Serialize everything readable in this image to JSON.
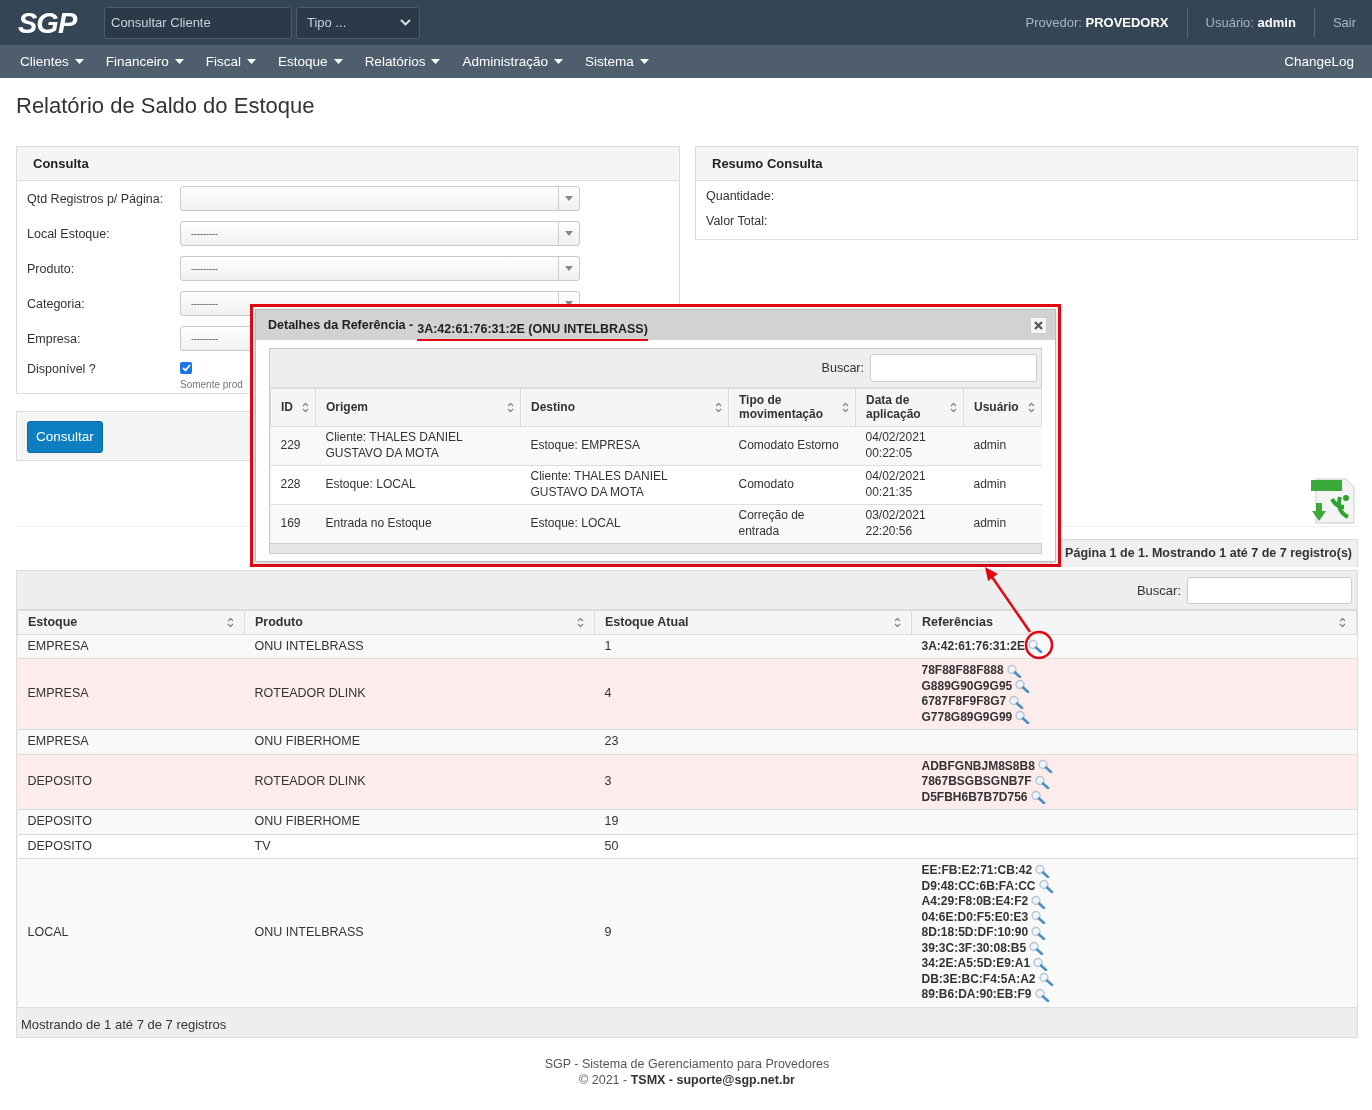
{
  "header": {
    "logo": "SGP",
    "search": {
      "placeholder": "Consultar Cliente"
    },
    "type_select": {
      "value": "Tipo ..."
    },
    "provider": "Provedor: **PROVEDORX**",
    "user": "Usuário: **admin**",
    "logout": "Sair"
  },
  "menu": {
    "items": [
      "Clientes",
      "Financeiro",
      "Fiscal",
      "Estoque",
      "Relatórios",
      "Administração",
      "Sistema"
    ],
    "changelog": "ChangeLog"
  },
  "page_title": "Relatório de Saldo do Estoque",
  "consulta": {
    "title": "Consulta",
    "fields": [
      {
        "label": "Qtd Registros p/ Página:",
        "kind": "select"
      },
      {
        "label": "Local Estoque:",
        "kind": "select",
        "value": "---------"
      },
      {
        "label": "Produto:",
        "kind": "select",
        "value": "---------"
      },
      {
        "label": "Categoria:",
        "kind": "select",
        "value": "---------"
      },
      {
        "label": "Empresa:",
        "kind": "select",
        "value": "---------"
      },
      {
        "label": "Disponível ?",
        "kind": "checkbox",
        "checked": true,
        "hint": "Somente prod"
      }
    ],
    "button": "Consultar"
  },
  "resumo": {
    "title": "Resumo Consulta",
    "fields": [
      "Quantidade:",
      "Valor Total:"
    ]
  },
  "results": {
    "pagination": "Página 1 de 1. Mostrando 1 até 7 de 7 registro(s)",
    "search_label": "Buscar:",
    "columns": [
      "Estoque",
      "Produto",
      "Estoque Atual",
      "Referências"
    ],
    "rows": [
      {
        "estoque": "EMPRESA",
        "produto": "ONU INTELBRASS",
        "estoque_atual": "1",
        "highlighted": false,
        "referencias": [
          "3A:42:61:76:31:2E"
        ]
      },
      {
        "estoque": "EMPRESA",
        "produto": "ROTEADOR DLINK",
        "estoque_atual": "4",
        "highlighted": true,
        "referencias": [
          "78F88F88F888",
          "G889G90G9G95",
          "6787F8F9F8G7",
          "G778G89G9G99"
        ]
      },
      {
        "estoque": "EMPRESA",
        "produto": "ONU FIBERHOME",
        "estoque_atual": "23",
        "highlighted": false
      },
      {
        "estoque": "DEPOSITO",
        "produto": "ROTEADOR DLINK",
        "estoque_atual": "3",
        "highlighted": true,
        "referencias": [
          "ADBFGNBJM8S8B8",
          "7867BSGBSGNB7F",
          "D5FBH6B7B7D756"
        ]
      },
      {
        "estoque": "DEPOSITO",
        "produto": "ONU FIBERHOME",
        "estoque_atual": "19",
        "highlighted": false
      },
      {
        "estoque": "DEPOSITO",
        "produto": "TV",
        "estoque_atual": "50",
        "highlighted": false
      },
      {
        "estoque": "LOCAL",
        "produto": "ONU INTELBRASS",
        "estoque_atual": "9",
        "highlighted": false,
        "referencias": [
          "EE:FB:E2:71:CB:42",
          "D9:48:CC:6B:FA:CC",
          "A4:29:F8:0B:E4:F2",
          "04:6E:D0:F5:E0:E3",
          "8D:18:5D:DF:10:90",
          "39:3C:3F:30:08:B5",
          "34:2E:A5:5D:E9:A1",
          "DB:3E:BC:F4:5A:A2",
          "89:B6:DA:90:EB:F9"
        ]
      }
    ],
    "footer": "Mostrando de 1 até 7 de 7 registros"
  },
  "modal": {
    "title": "Detalhes da Referência -",
    "reference": "3A:42:61:76:31:2E (ONU INTELBRASS)",
    "search_label": "Buscar:",
    "columns": [
      "ID",
      "Origem",
      "Destino",
      "Tipo de movimentação",
      "Data de aplicação",
      "Usuário"
    ],
    "rows": [
      {
        "cells": [
          "229",
          "Cliente: THALES DANIEL GUSTAVO DA MOTA",
          "Estoque: EMPRESA",
          "Comodato Estorno",
          "04/02/2021 00:22:05",
          "admin"
        ]
      },
      {
        "cells": [
          "228",
          "Estoque: LOCAL",
          "Cliente: THALES DANIEL GUSTAVO DA MOTA",
          "Comodato",
          "04/02/2021 00:21:35",
          "admin"
        ]
      },
      {
        "cells": [
          "169",
          "Entrada no Estoque",
          "Estoque: LOCAL",
          "Correção de entrada",
          "03/02/2021 22:20:56",
          "admin"
        ]
      }
    ]
  },
  "footer": {
    "line1": "SGP - Sistema de Gerenciamento para Provedores",
    "line2": "© 2021 - **TSMX - suporte@sgp.net.br**"
  }
}
